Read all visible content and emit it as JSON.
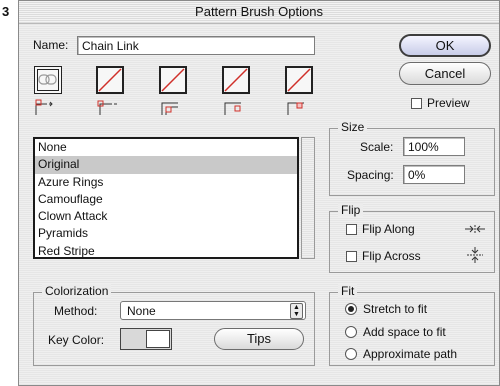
{
  "figure_number": "3",
  "title": "Pattern Brush Options",
  "name_label": "Name:",
  "name_value": "Chain Link",
  "buttons": {
    "ok": "OK",
    "cancel": "Cancel",
    "tips": "Tips"
  },
  "preview_label": "Preview",
  "tiles": [
    {
      "id": "side-tile",
      "icon": "chain-link-icon"
    },
    {
      "id": "outer-corner-tile",
      "icon": "no-tile-icon"
    },
    {
      "id": "inner-corner-tile",
      "icon": "no-tile-icon"
    },
    {
      "id": "start-tile",
      "icon": "no-tile-icon"
    },
    {
      "id": "end-tile",
      "icon": "no-tile-icon"
    }
  ],
  "pattern_list": {
    "items": [
      "None",
      "Original",
      "Azure Rings",
      "Camouflage",
      "Clown Attack",
      "Pyramids",
      "Red Stripe"
    ],
    "selected": "Original"
  },
  "size": {
    "title": "Size",
    "scale_label": "Scale:",
    "scale_value": "100%",
    "spacing_label": "Spacing:",
    "spacing_value": "0%"
  },
  "flip": {
    "title": "Flip",
    "along_label": "Flip Along",
    "across_label": "Flip Across"
  },
  "colorization": {
    "title": "Colorization",
    "method_label": "Method:",
    "method_value": "None",
    "key_color_label": "Key Color:"
  },
  "fit": {
    "title": "Fit",
    "options": [
      "Stretch to fit",
      "Add space to fit",
      "Approximate path"
    ],
    "selected": "Stretch to fit"
  },
  "colors": {
    "no_tile_slash": "#d0302a",
    "selection": "#c9c9c9"
  }
}
